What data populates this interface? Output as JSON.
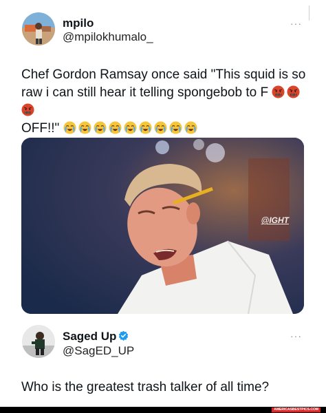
{
  "tweet": {
    "display_name": "mpilo",
    "handle": "@mpilokhumalo_",
    "more_label": "···",
    "text_main": "Chef Gordon Ramsay once said \"This squid is so raw i can still hear it telling spongebob to F ",
    "text_end": "OFF!!\"",
    "angry_emoji_count": 3,
    "crying_emoji_count": 9,
    "image_watermark": "@IGHT"
  },
  "reply": {
    "display_name": "Saged Up",
    "handle": "@SagED_UP",
    "more_label": "···",
    "verified": true,
    "text": "Who is the greatest trash talker of all time?"
  },
  "footer": {
    "site_tag": "AMERICASBESTPICS.COM"
  },
  "colors": {
    "verified_blue": "#1d9bf0",
    "text": "#0f1419",
    "footer_tag": "#e02424"
  }
}
